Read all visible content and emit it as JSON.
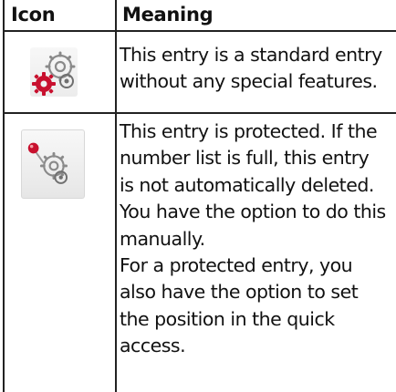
{
  "table": {
    "headers": {
      "icon": "Icon",
      "meaning": "Meaning"
    },
    "rows": [
      {
        "icon": "standard-entry-icon",
        "lines": [
          "This entry is a standard entry",
          "without any special features."
        ]
      },
      {
        "icon": "protected-entry-icon",
        "lines": [
          "This entry is protected. If the",
          "number list is full, this entry",
          "is not automatically deleted.",
          "You have the option to do this",
          "manually.",
          "For a protected entry, you",
          "also have the option to set",
          "the position in the quick",
          "access."
        ]
      }
    ]
  },
  "colors": {
    "border": "#222222",
    "text": "#111111",
    "accent_red": "#c8102e",
    "gear_gray": "#8a8a8a"
  }
}
